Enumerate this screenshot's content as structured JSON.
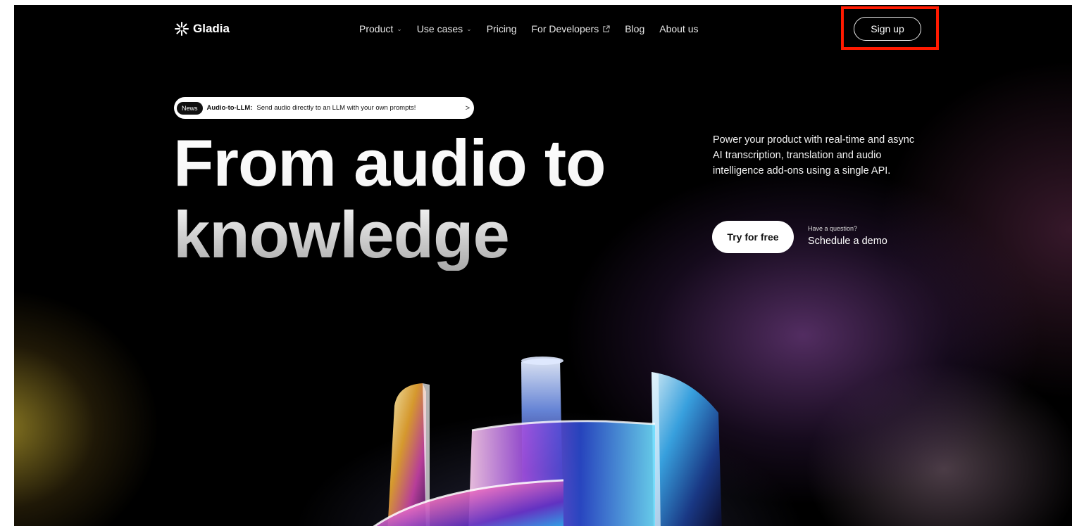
{
  "brand": {
    "name": "Gladia",
    "icon": "gladia-logo-icon"
  },
  "nav": {
    "items": [
      {
        "label": "Product",
        "icon": "chevron-down-icon"
      },
      {
        "label": "Use cases",
        "icon": "chevron-down-icon"
      },
      {
        "label": "Pricing"
      },
      {
        "label": "For Developers",
        "icon": "external-link-icon"
      },
      {
        "label": "Blog"
      },
      {
        "label": "About us"
      }
    ],
    "signup_label": "Sign up"
  },
  "news": {
    "badge": "News",
    "title": "Audio-to-LLM:",
    "text": "Send audio directly to an LLM with your own prompts!",
    "chevron": ">"
  },
  "hero": {
    "headline_line1": "From audio to",
    "headline_line2": "knowledge",
    "description": "Power your product with real-time and async AI transcription, translation and audio intelligence add-ons using a single API.",
    "cta_label": "Try for free",
    "question": "Have a question?",
    "demo_label": "Schedule a demo"
  },
  "colors": {
    "background": "#000000",
    "highlight": "#ff1a00",
    "button_bg": "#ffffff"
  }
}
